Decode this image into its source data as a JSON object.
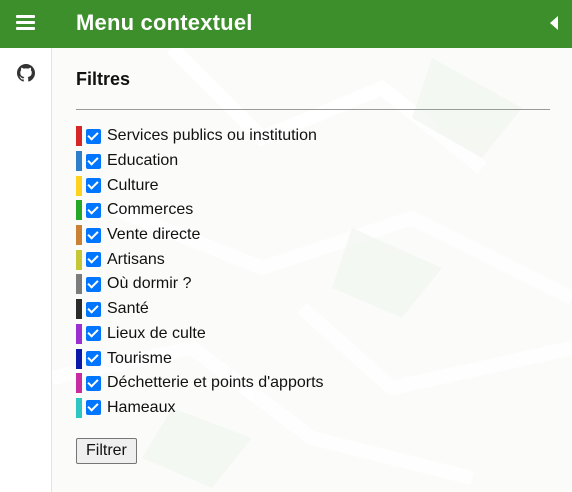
{
  "header": {
    "title": "Menu contextuel",
    "menu_icon": "hamburger-menu-icon",
    "collapse_icon": "caret-left-icon",
    "background_color": "#3c8f2a"
  },
  "left_rail": {
    "github_icon": "github-icon"
  },
  "filters": {
    "title": "Filtres",
    "items": [
      {
        "label": "Services publics ou institution",
        "color": "#d62728",
        "checked": true
      },
      {
        "label": "Education",
        "color": "#2f7ec9",
        "checked": true
      },
      {
        "label": "Culture",
        "color": "#ffd21f",
        "checked": true
      },
      {
        "label": "Commerces",
        "color": "#25a829",
        "checked": true
      },
      {
        "label": "Vente directe",
        "color": "#c88135",
        "checked": true
      },
      {
        "label": "Artisans",
        "color": "#c6c735",
        "checked": true
      },
      {
        "label": "Où dormir ?",
        "color": "#7c7c7c",
        "checked": true
      },
      {
        "label": "Santé",
        "color": "#2b2b2b",
        "checked": true
      },
      {
        "label": "Lieux de culte",
        "color": "#9b2fcf",
        "checked": true
      },
      {
        "label": "Tourisme",
        "color": "#0b1aa8",
        "checked": true
      },
      {
        "label": "Déchetterie et points d'apports",
        "color": "#c82ca0",
        "checked": true
      },
      {
        "label": "Hameaux",
        "color": "#2cc7c2",
        "checked": true
      }
    ],
    "button_label": "Filtrer"
  }
}
